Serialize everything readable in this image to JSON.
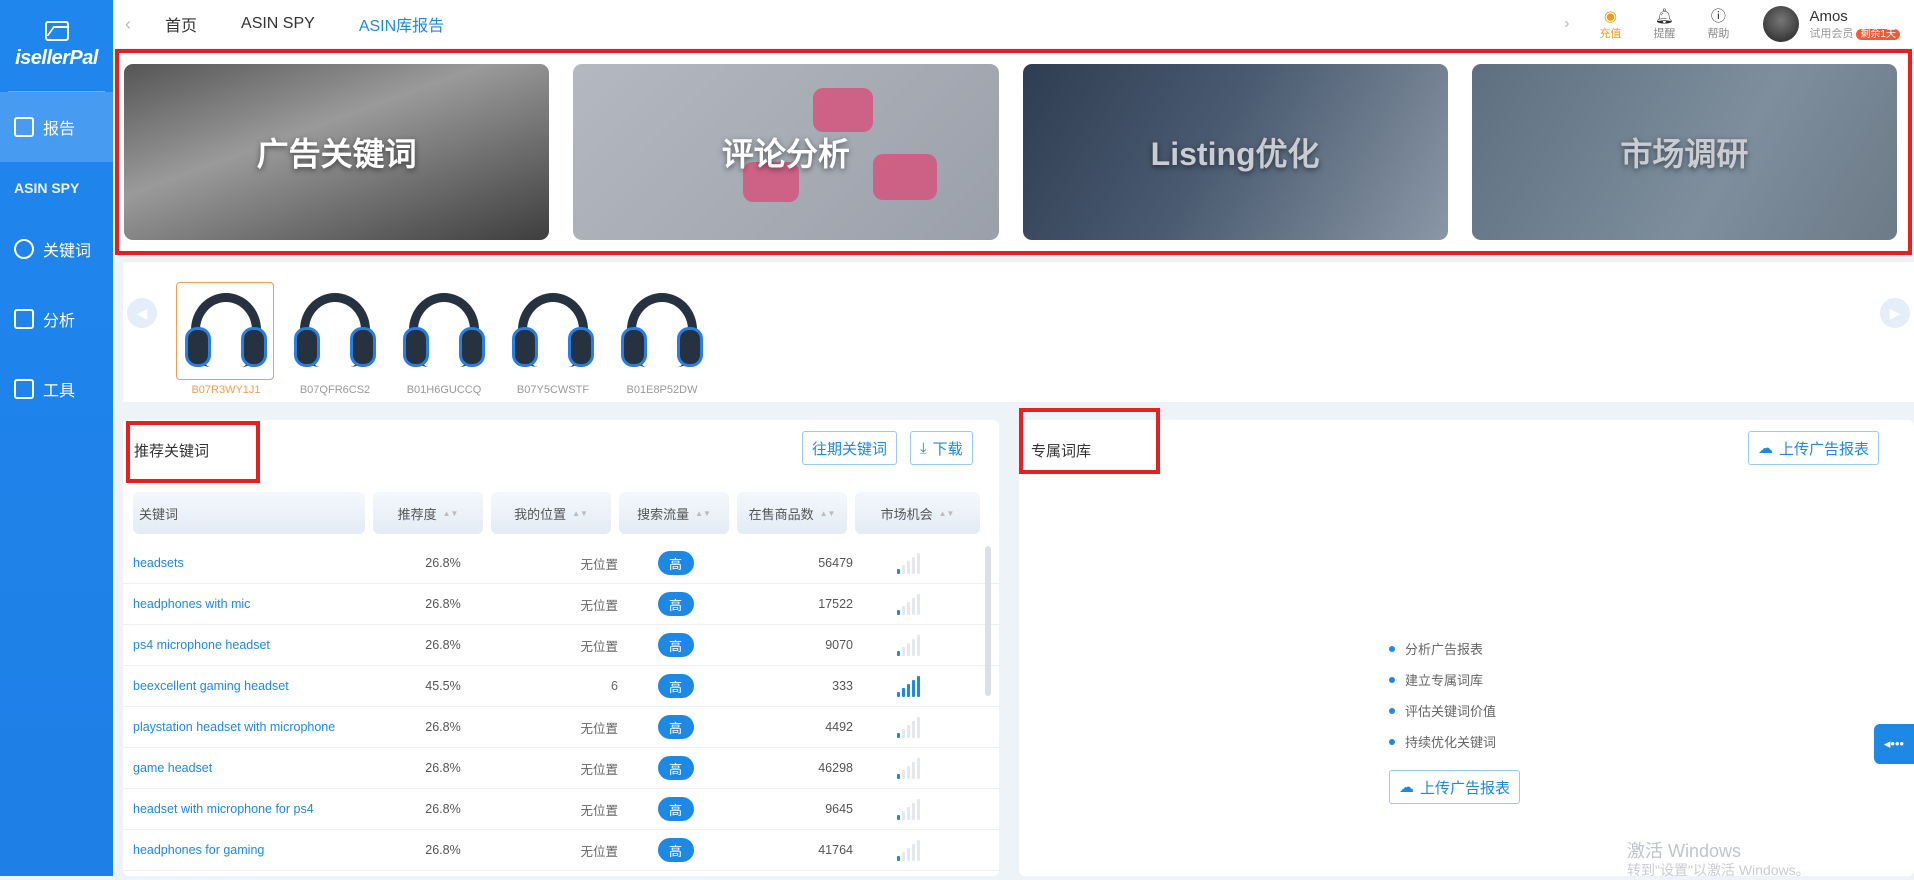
{
  "brand": {
    "name": "isellerPal"
  },
  "sidebar": {
    "items": [
      {
        "label": "报告",
        "icon": "report-icon",
        "active": true
      },
      {
        "label": "ASIN SPY",
        "plain": true
      },
      {
        "label": "关键词",
        "icon": "target-icon"
      },
      {
        "label": "分析",
        "icon": "chart-icon"
      },
      {
        "label": "工具",
        "icon": "toolbox-icon"
      }
    ]
  },
  "topbar": {
    "tabs": [
      "首页",
      "ASIN SPY",
      "ASIN库报告"
    ],
    "active_tab": "ASIN库报告",
    "tools": [
      {
        "label": "充值",
        "icon": "recharge-icon"
      },
      {
        "label": "提醒",
        "icon": "bell-icon"
      },
      {
        "label": "帮助",
        "icon": "help-icon"
      }
    ],
    "user": {
      "name": "Amos",
      "tier": "试用会员",
      "trial": "剩余1天"
    }
  },
  "banners": [
    "广告关键词",
    "评论分析",
    "Listing优化",
    "市场调研"
  ],
  "products": [
    {
      "asin": "B07R3WY1J1",
      "selected": true
    },
    {
      "asin": "B07QFR6CS2"
    },
    {
      "asin": "B01H6GUCCQ"
    },
    {
      "asin": "B07Y5CWSTF"
    },
    {
      "asin": "B01E8P52DW"
    }
  ],
  "recommend": {
    "title": "推荐关键词",
    "history_button": "往期关键词",
    "download_button": "下载",
    "columns": [
      "关键词",
      "推荐度",
      "我的位置",
      "搜索流量",
      "在售商品数",
      "市场机会"
    ],
    "rows": [
      {
        "keyword": "headsets",
        "score": "26.8%",
        "position": "无位置",
        "traffic": "高",
        "count": "56479",
        "opportunity": 1
      },
      {
        "keyword": "headphones with mic",
        "score": "26.8%",
        "position": "无位置",
        "traffic": "高",
        "count": "17522",
        "opportunity": 1
      },
      {
        "keyword": "ps4 microphone headset",
        "score": "26.8%",
        "position": "无位置",
        "traffic": "高",
        "count": "9070",
        "opportunity": 1
      },
      {
        "keyword": "beexcellent gaming headset",
        "score": "45.5%",
        "position": "6",
        "traffic": "高",
        "count": "333",
        "opportunity": 5
      },
      {
        "keyword": "playstation headset with microphone",
        "score": "26.8%",
        "position": "无位置",
        "traffic": "高",
        "count": "4492",
        "opportunity": 1
      },
      {
        "keyword": "game headset",
        "score": "26.8%",
        "position": "无位置",
        "traffic": "高",
        "count": "46298",
        "opportunity": 1
      },
      {
        "keyword": "headset with microphone for ps4",
        "score": "26.8%",
        "position": "无位置",
        "traffic": "高",
        "count": "9645",
        "opportunity": 1
      },
      {
        "keyword": "headphones for gaming",
        "score": "26.8%",
        "position": "无位置",
        "traffic": "高",
        "count": "41764",
        "opportunity": 1
      }
    ]
  },
  "exclusive": {
    "title": "专属词库",
    "upload_button": "上传广告报表",
    "tips": [
      "分析广告报表",
      "建立专属词库",
      "评估关键词价值",
      "持续优化关键词"
    ],
    "center_button": "上传广告报表"
  },
  "watermark": {
    "line1": "激活 Windows",
    "line2": "转到\"设置\"以激活 Windows。"
  },
  "colors": {
    "accent": "#1e88e5",
    "highlight": "#e62020",
    "selected": "#f39c4b"
  }
}
